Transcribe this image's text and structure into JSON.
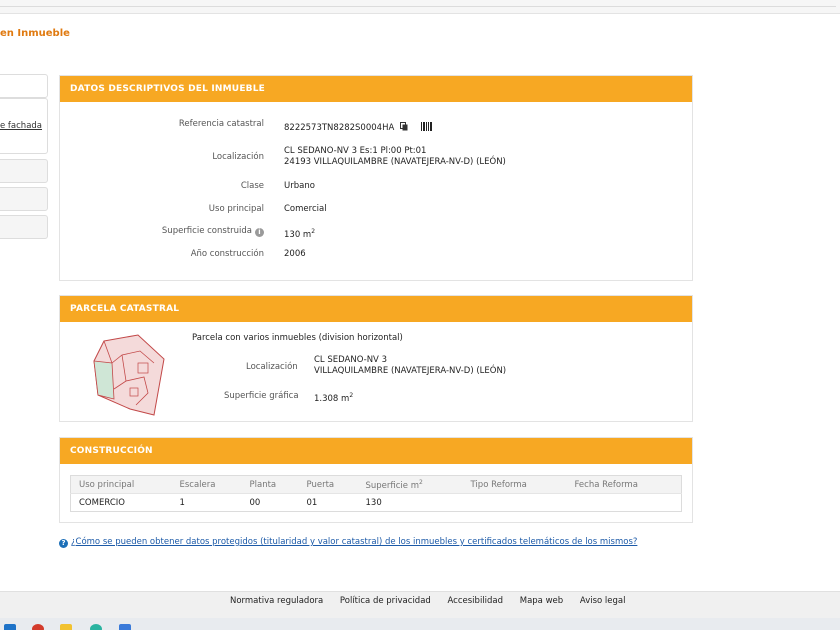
{
  "page": {
    "title": "en Inmueble"
  },
  "sidebar": {
    "link_label": "e fachada"
  },
  "descriptivos": {
    "header": "DATOS DESCRIPTIVOS DEL INMUEBLE",
    "ref_label": "Referencia catastral",
    "ref_value": "8222573TN8282S0004HA",
    "loc_label": "Localización",
    "loc_line1": "CL SEDANO-NV 3 Es:1 Pl:00 Pt:01",
    "loc_line2": "24193 VILLAQUILAMBRE (NAVATEJERA-NV-D) (LEÓN)",
    "clase_label": "Clase",
    "clase_value": "Urbano",
    "uso_label": "Uso principal",
    "uso_value": "Comercial",
    "sup_label": "Superficie construida",
    "sup_value": "130 m",
    "sup_sup": "2",
    "anio_label": "Año construcción",
    "anio_value": "2006"
  },
  "parcela": {
    "header": "PARCELA CATASTRAL",
    "subtitle": "Parcela con varios inmuebles (division horizontal)",
    "loc_label": "Localización",
    "loc_line1": "CL SEDANO-NV 3",
    "loc_line2": "VILLAQUILAMBRE (NAVATEJERA-NV-D) (LEÓN)",
    "sup_label": "Superficie gráfica",
    "sup_value": "1.308 m",
    "sup_sup": "2"
  },
  "construccion": {
    "header": "CONSTRUCCIÓN",
    "columns": [
      "Uso principal",
      "Escalera",
      "Planta",
      "Puerta",
      "Superficie m",
      "Tipo Reforma",
      "Fecha Reforma"
    ],
    "superficie_sup": "2",
    "rows": [
      [
        "COMERCIO",
        "1",
        "00",
        "01",
        "130",
        "",
        ""
      ]
    ]
  },
  "faq": {
    "text": "¿Cómo se pueden obtener datos protegidos (titularidad y valor catastral) de los inmuebles y certificados telemáticos de los mismos?"
  },
  "footer": {
    "links": [
      "Normativa reguladora",
      "Política de privacidad",
      "Accesibilidad",
      "Mapa web",
      "Aviso legal"
    ]
  },
  "colors": {
    "accent": "#f7a823",
    "title": "#e07a10",
    "link": "#1c5aa8"
  }
}
